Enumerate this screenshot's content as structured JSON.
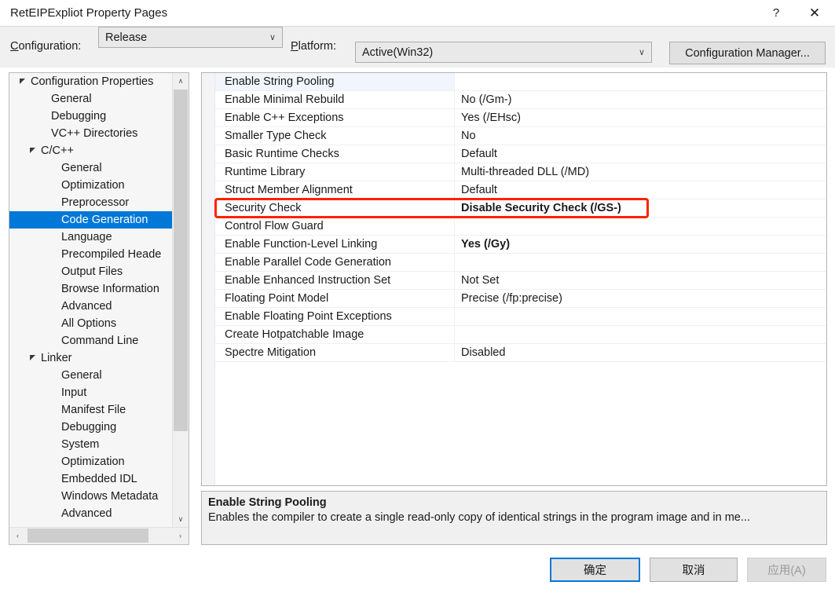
{
  "window": {
    "title": "RetEIPExpliot Property Pages",
    "help_label": "?",
    "close_label": "✕"
  },
  "configbar": {
    "configuration_label": "Configuration:",
    "configuration_value": "Release",
    "platform_label": "Platform:",
    "platform_value": "Active(Win32)",
    "configuration_manager_label": "Configuration Manager...",
    "dropdown_arrow": "∨"
  },
  "tree": {
    "items": [
      {
        "label": "Configuration Properties",
        "level": 0,
        "twisty": "expanded",
        "selected": false
      },
      {
        "label": "General",
        "level": 1,
        "twisty": "none",
        "selected": false
      },
      {
        "label": "Debugging",
        "level": 1,
        "twisty": "none",
        "selected": false
      },
      {
        "label": "VC++ Directories",
        "level": 1,
        "twisty": "none",
        "selected": false
      },
      {
        "label": "C/C++",
        "level": 1,
        "twisty": "expanded",
        "selected": false
      },
      {
        "label": "General",
        "level": 2,
        "twisty": "none",
        "selected": false
      },
      {
        "label": "Optimization",
        "level": 2,
        "twisty": "none",
        "selected": false
      },
      {
        "label": "Preprocessor",
        "level": 2,
        "twisty": "none",
        "selected": false
      },
      {
        "label": "Code Generation",
        "level": 2,
        "twisty": "none",
        "selected": true
      },
      {
        "label": "Language",
        "level": 2,
        "twisty": "none",
        "selected": false
      },
      {
        "label": "Precompiled Heade",
        "level": 2,
        "twisty": "none",
        "selected": false
      },
      {
        "label": "Output Files",
        "level": 2,
        "twisty": "none",
        "selected": false
      },
      {
        "label": "Browse Information",
        "level": 2,
        "twisty": "none",
        "selected": false
      },
      {
        "label": "Advanced",
        "level": 2,
        "twisty": "none",
        "selected": false
      },
      {
        "label": "All Options",
        "level": 2,
        "twisty": "none",
        "selected": false
      },
      {
        "label": "Command Line",
        "level": 2,
        "twisty": "none",
        "selected": false
      },
      {
        "label": "Linker",
        "level": 1,
        "twisty": "expanded",
        "selected": false
      },
      {
        "label": "General",
        "level": 2,
        "twisty": "none",
        "selected": false
      },
      {
        "label": "Input",
        "level": 2,
        "twisty": "none",
        "selected": false
      },
      {
        "label": "Manifest File",
        "level": 2,
        "twisty": "none",
        "selected": false
      },
      {
        "label": "Debugging",
        "level": 2,
        "twisty": "none",
        "selected": false
      },
      {
        "label": "System",
        "level": 2,
        "twisty": "none",
        "selected": false
      },
      {
        "label": "Optimization",
        "level": 2,
        "twisty": "none",
        "selected": false
      },
      {
        "label": "Embedded IDL",
        "level": 2,
        "twisty": "none",
        "selected": false
      },
      {
        "label": "Windows Metadata",
        "level": 2,
        "twisty": "none",
        "selected": false
      },
      {
        "label": "Advanced",
        "level": 2,
        "twisty": "none",
        "selected": false
      }
    ],
    "scroll_up_glyph": "∧",
    "scroll_down_glyph": "∨",
    "scroll_left_glyph": "‹",
    "scroll_right_glyph": "›"
  },
  "grid": {
    "rows": [
      {
        "name": "Enable String Pooling",
        "value": "",
        "bold": false,
        "selected": true,
        "highlighted": false
      },
      {
        "name": "Enable Minimal Rebuild",
        "value": "No (/Gm-)",
        "bold": false,
        "selected": false,
        "highlighted": false
      },
      {
        "name": "Enable C++ Exceptions",
        "value": "Yes (/EHsc)",
        "bold": false,
        "selected": false,
        "highlighted": false
      },
      {
        "name": "Smaller Type Check",
        "value": "No",
        "bold": false,
        "selected": false,
        "highlighted": false
      },
      {
        "name": "Basic Runtime Checks",
        "value": "Default",
        "bold": false,
        "selected": false,
        "highlighted": false
      },
      {
        "name": "Runtime Library",
        "value": "Multi-threaded DLL (/MD)",
        "bold": false,
        "selected": false,
        "highlighted": false
      },
      {
        "name": "Struct Member Alignment",
        "value": "Default",
        "bold": false,
        "selected": false,
        "highlighted": false
      },
      {
        "name": "Security Check",
        "value": "Disable Security Check (/GS-)",
        "bold": true,
        "selected": false,
        "highlighted": true
      },
      {
        "name": "Control Flow Guard",
        "value": "",
        "bold": false,
        "selected": false,
        "highlighted": false
      },
      {
        "name": "Enable Function-Level Linking",
        "value": "Yes (/Gy)",
        "bold": true,
        "selected": false,
        "highlighted": false
      },
      {
        "name": "Enable Parallel Code Generation",
        "value": "",
        "bold": false,
        "selected": false,
        "highlighted": false
      },
      {
        "name": "Enable Enhanced Instruction Set",
        "value": "Not Set",
        "bold": false,
        "selected": false,
        "highlighted": false
      },
      {
        "name": "Floating Point Model",
        "value": "Precise (/fp:precise)",
        "bold": false,
        "selected": false,
        "highlighted": false
      },
      {
        "name": "Enable Floating Point Exceptions",
        "value": "",
        "bold": false,
        "selected": false,
        "highlighted": false
      },
      {
        "name": "Create Hotpatchable Image",
        "value": "",
        "bold": false,
        "selected": false,
        "highlighted": false
      },
      {
        "name": "Spectre Mitigation",
        "value": "Disabled",
        "bold": false,
        "selected": false,
        "highlighted": false
      }
    ],
    "highlight_color": "#ff2200"
  },
  "description": {
    "title": "Enable String Pooling",
    "body": "Enables the compiler to create a single read-only copy of identical strings in the program image and in me..."
  },
  "footer": {
    "ok_label": "确定",
    "cancel_label": "取消",
    "apply_label": "应用(A)",
    "apply_disabled": true
  },
  "colors": {
    "accent": "#0078d7",
    "highlight": "#ff2200",
    "dialog_bg": "#f0f0f0"
  }
}
